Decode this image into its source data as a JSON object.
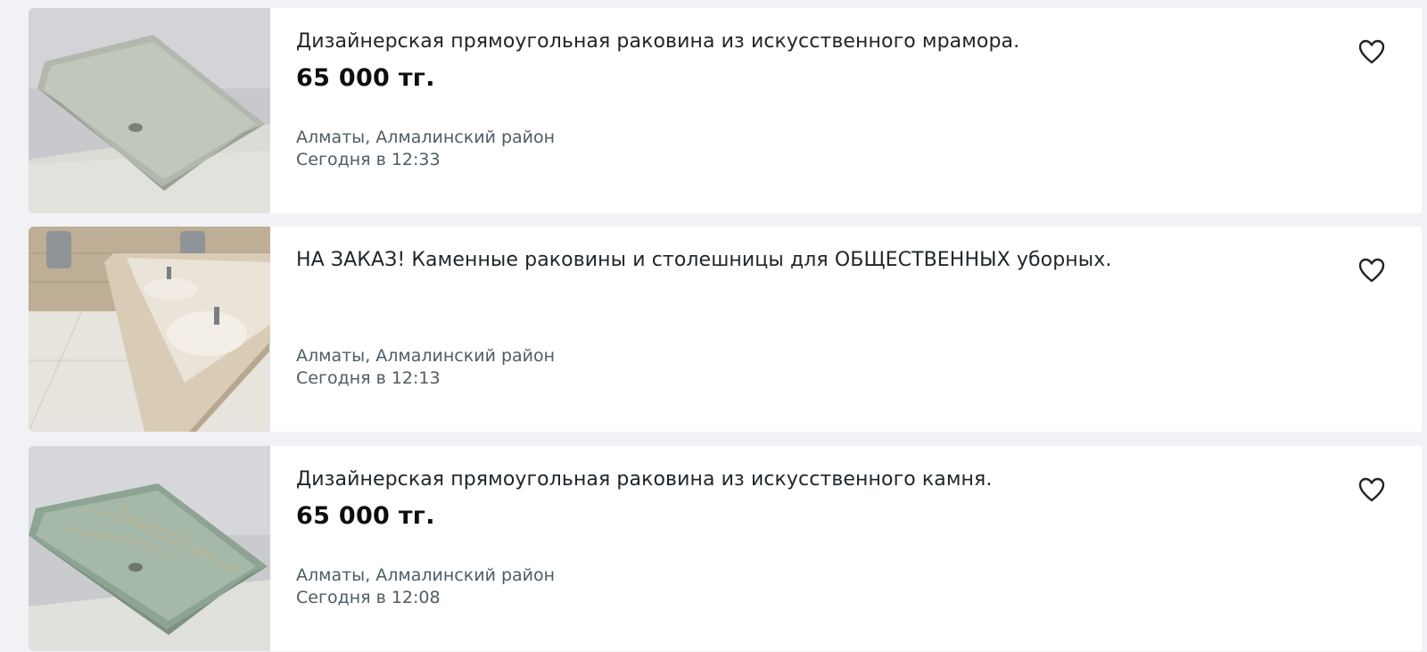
{
  "listings": [
    {
      "title": "Дизайнерская прямоугольная раковина из искусственного мрамора.",
      "price": "65 000 тг.",
      "location": "Алматы, Алмалинский район",
      "date": "Сегодня в 12:33",
      "favorite_icon": "heart-outline-icon"
    },
    {
      "title": "НА ЗАКАЗ! Каменные раковины и столешницы для ОБЩЕСТВЕННЫХ уборных.",
      "price": "",
      "location": "Алматы, Алмалинский район",
      "date": "Сегодня в 12:13",
      "favorite_icon": "heart-outline-icon"
    },
    {
      "title": "Дизайнерская прямоугольная раковина из искусственного камня.",
      "price": "65 000 тг.",
      "location": "Алматы, Алмалинский район",
      "date": "Сегодня в 12:08",
      "favorite_icon": "heart-outline-icon"
    }
  ],
  "colors": {
    "page_background": "#f0f2f5",
    "card_background": "#ffffff",
    "title_text": "#1f2529",
    "price_text": "#0c0f11",
    "meta_text": "#4f5c63"
  }
}
